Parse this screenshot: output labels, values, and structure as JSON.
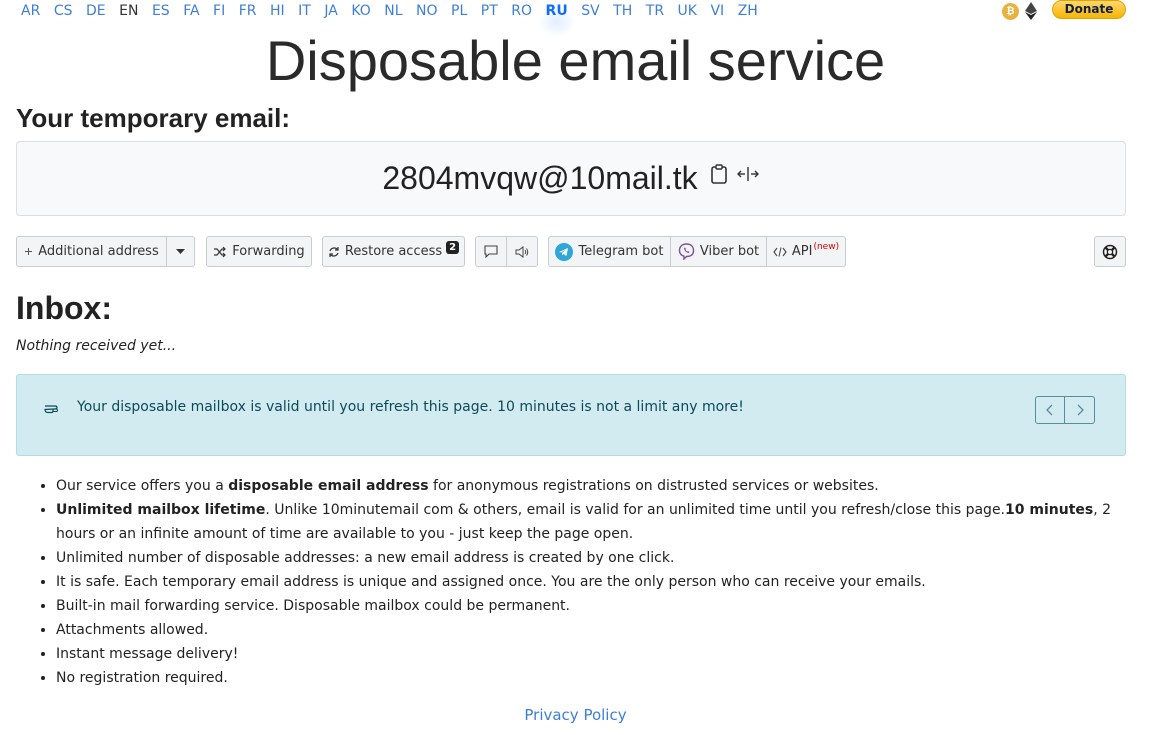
{
  "languages": [
    {
      "code": "AR",
      "state": "link"
    },
    {
      "code": "CS",
      "state": "link"
    },
    {
      "code": "DE",
      "state": "link"
    },
    {
      "code": "EN",
      "state": "plain"
    },
    {
      "code": "ES",
      "state": "link"
    },
    {
      "code": "FA",
      "state": "link"
    },
    {
      "code": "FI",
      "state": "link"
    },
    {
      "code": "FR",
      "state": "link"
    },
    {
      "code": "HI",
      "state": "link"
    },
    {
      "code": "IT",
      "state": "link"
    },
    {
      "code": "JA",
      "state": "link"
    },
    {
      "code": "KO",
      "state": "link"
    },
    {
      "code": "NL",
      "state": "link"
    },
    {
      "code": "NO",
      "state": "link"
    },
    {
      "code": "PL",
      "state": "link"
    },
    {
      "code": "PT",
      "state": "link"
    },
    {
      "code": "RO",
      "state": "link"
    },
    {
      "code": "RU",
      "state": "active"
    },
    {
      "code": "SV",
      "state": "link"
    },
    {
      "code": "TH",
      "state": "link"
    },
    {
      "code": "TR",
      "state": "link"
    },
    {
      "code": "UK",
      "state": "link"
    },
    {
      "code": "VI",
      "state": "link"
    },
    {
      "code": "ZH",
      "state": "link"
    }
  ],
  "header": {
    "donate_label": "Donate",
    "title": "Disposable email service",
    "crypto_icons": [
      "bitcoin-icon",
      "ethereum-icon"
    ]
  },
  "email": {
    "heading": "Your temporary email:",
    "address": "2804mvqw@10mail.tk",
    "icons": [
      "clipboard-icon",
      "resize-icon"
    ]
  },
  "toolbar": {
    "additional_address": "Additional address",
    "forwarding": "Forwarding",
    "restore_access": "Restore access",
    "restore_badge": "2",
    "telegram_bot": "Telegram bot",
    "viber_bot": "Viber bot",
    "api": "API",
    "api_new": "(new)"
  },
  "inbox": {
    "heading": "Inbox:",
    "empty_text": "Nothing received yet..."
  },
  "alert": {
    "text": "Your disposable mailbox is valid until you refresh this page. 10 minutes is not a limit any more!"
  },
  "features": [
    {
      "parts": [
        {
          "t": "Our service offers you a ",
          "b": false
        },
        {
          "t": "disposable email address",
          "b": true
        },
        {
          "t": " for anonymous registrations on distrusted services or websites.",
          "b": false
        }
      ]
    },
    {
      "parts": [
        {
          "t": "Unlimited mailbox lifetime",
          "b": true
        },
        {
          "t": ". Unlike 10minutemail com & others, email is valid for an unlimited time until you refresh/close this page.",
          "b": false
        },
        {
          "t": "10 minutes",
          "b": true
        },
        {
          "t": ", 2 hours or an infinite amount of time are available to you - just keep the page open.",
          "b": false
        }
      ]
    },
    {
      "parts": [
        {
          "t": "Unlimited number of disposable addresses: a new email address is created by one click.",
          "b": false
        }
      ]
    },
    {
      "parts": [
        {
          "t": "It is safe. Each temporary email address is unique and assigned once. You are the only person who can receive your emails.",
          "b": false
        }
      ]
    },
    {
      "parts": [
        {
          "t": "Built-in mail forwarding service. Disposable mailbox could be permanent.",
          "b": false
        }
      ]
    },
    {
      "parts": [
        {
          "t": "Attachments allowed.",
          "b": false
        }
      ]
    },
    {
      "parts": [
        {
          "t": "Instant message delivery!",
          "b": false
        }
      ]
    },
    {
      "parts": [
        {
          "t": "No registration required.",
          "b": false
        }
      ]
    }
  ],
  "footer": {
    "privacy_policy": "Privacy Policy"
  },
  "colors": {
    "link": "#3e7fd6",
    "active_lang": "#0d6efd",
    "alert_bg": "#d1ebf1",
    "donate": "#f7b500",
    "telegram": "#2ea6da",
    "viber": "#7c529e"
  }
}
